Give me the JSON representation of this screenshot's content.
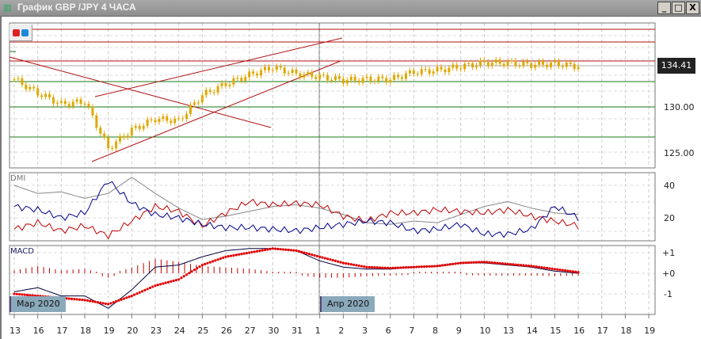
{
  "window": {
    "title": "График GBP /JPY  4 ЧАСА",
    "buttons": [
      "_",
      "□",
      "X"
    ]
  },
  "colors": {
    "candle": "#e0a800",
    "bull_line": "#c00000",
    "support": "#1a7a1a",
    "adx": "#888888",
    "plus_di": "#c00000",
    "minus_di": "#00008b",
    "macd": "#00003f",
    "signal": "#e00000"
  },
  "main": {
    "current_price": "134.41",
    "y_ticks": [
      "130.00",
      "125.00"
    ]
  },
  "dmi": {
    "label": "DMI",
    "y_ticks": [
      "40",
      "20"
    ]
  },
  "macd": {
    "label": "MACD",
    "y_ticks": [
      "+1",
      "+0",
      "-1"
    ]
  },
  "month_markers": [
    "Мар 2020",
    "Апр 2020"
  ],
  "x_labels": [
    "13",
    "16",
    "17",
    "18",
    "19",
    "20",
    "23",
    "24",
    "25",
    "26",
    "27",
    "30",
    "31",
    "1",
    "2",
    "3",
    "6",
    "7",
    "8",
    "9",
    "10",
    "13",
    "14",
    "15",
    "16",
    "17",
    "18",
    "19"
  ],
  "chart_data": {
    "type": "line",
    "price_close": [
      133,
      131.5,
      130.3,
      130.6,
      125.5,
      127.5,
      128.7,
      128.5,
      131.3,
      132.5,
      133.5,
      134.3,
      133.6,
      133.3,
      132.9,
      133,
      133,
      133.8,
      134,
      134.4,
      134.8,
      134.8,
      134.6,
      134.7,
      134.41
    ],
    "adx": [
      40,
      35,
      36,
      32,
      35,
      45,
      35,
      26,
      19,
      21,
      24,
      27,
      28,
      26,
      22,
      17,
      16,
      18,
      17,
      22,
      27,
      30,
      26,
      23,
      22
    ],
    "plus_di": [
      13,
      17,
      12,
      15,
      9,
      18,
      27,
      24,
      15,
      23,
      30,
      28,
      29,
      28,
      21,
      18,
      23,
      23,
      25,
      24,
      23,
      25,
      21,
      18,
      15
    ],
    "minus_di": [
      27,
      25,
      20,
      23,
      43,
      29,
      22,
      20,
      16,
      14,
      14,
      13,
      12,
      14,
      16,
      18,
      17,
      12,
      13,
      16,
      10,
      10,
      13,
      27,
      20
    ],
    "macd_line": [
      -0.9,
      -0.7,
      -1.1,
      -1.1,
      -1.7,
      -0.8,
      0.3,
      0.4,
      0.8,
      1.1,
      1.2,
      1.2,
      1.1,
      0.6,
      0.3,
      0.2,
      0.2,
      0.3,
      0.35,
      0.5,
      0.5,
      0.4,
      0.3,
      0.1,
      0
    ],
    "signal_line": [
      -1,
      -1.1,
      -1.2,
      -1.3,
      -1.5,
      -1.1,
      -0.6,
      -0.3,
      0.4,
      0.8,
      1.0,
      1.2,
      1.1,
      0.8,
      0.5,
      0.3,
      0.25,
      0.3,
      0.35,
      0.5,
      0.55,
      0.45,
      0.35,
      0.2,
      0.05
    ]
  }
}
